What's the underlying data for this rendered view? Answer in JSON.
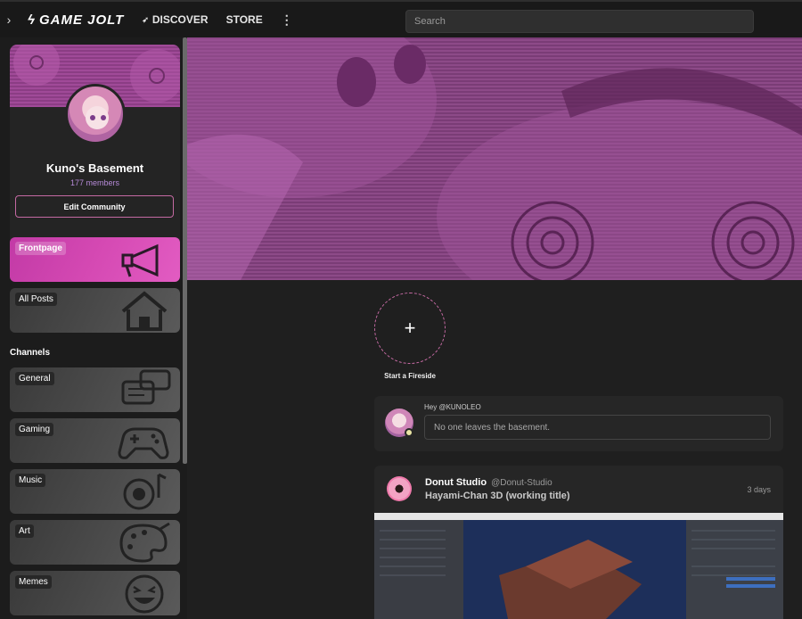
{
  "topbar": {
    "logo": "GAME JOLT",
    "nav": [
      {
        "label": "DISCOVER",
        "icon": "rocket-icon"
      },
      {
        "label": "STORE"
      }
    ],
    "more_icon": "more-vertical-icon",
    "search_placeholder": "Search"
  },
  "community": {
    "name": "Kuno's Basement",
    "members": "177 members",
    "edit_label": "Edit Community"
  },
  "channels_heading": "Channels",
  "nav_items": [
    {
      "label": "Frontpage",
      "icon": "megaphone-icon",
      "active": true
    },
    {
      "label": "All Posts",
      "icon": "home-icon"
    }
  ],
  "channels": [
    {
      "label": "General",
      "icon": "chat-bubbles-icon"
    },
    {
      "label": "Gaming",
      "icon": "gamepad-icon"
    },
    {
      "label": "Music",
      "icon": "music-speaker-icon"
    },
    {
      "label": "Art",
      "icon": "palette-icon"
    },
    {
      "label": "Memes",
      "icon": "laughing-face-icon"
    }
  ],
  "fireside": {
    "label": "Start a Fireside"
  },
  "compose": {
    "greeting": "Hey @KUNOLEO",
    "placeholder": "No one leaves the basement."
  },
  "post": {
    "author": "Donut Studio",
    "handle": "@Donut-Studio",
    "game": "Hayami-Chan 3D (working title)",
    "time": "3 days"
  },
  "colors": {
    "accent": "#c56aa3",
    "active_channel": "#d549b3",
    "hero_purple": "#8d4a88"
  }
}
